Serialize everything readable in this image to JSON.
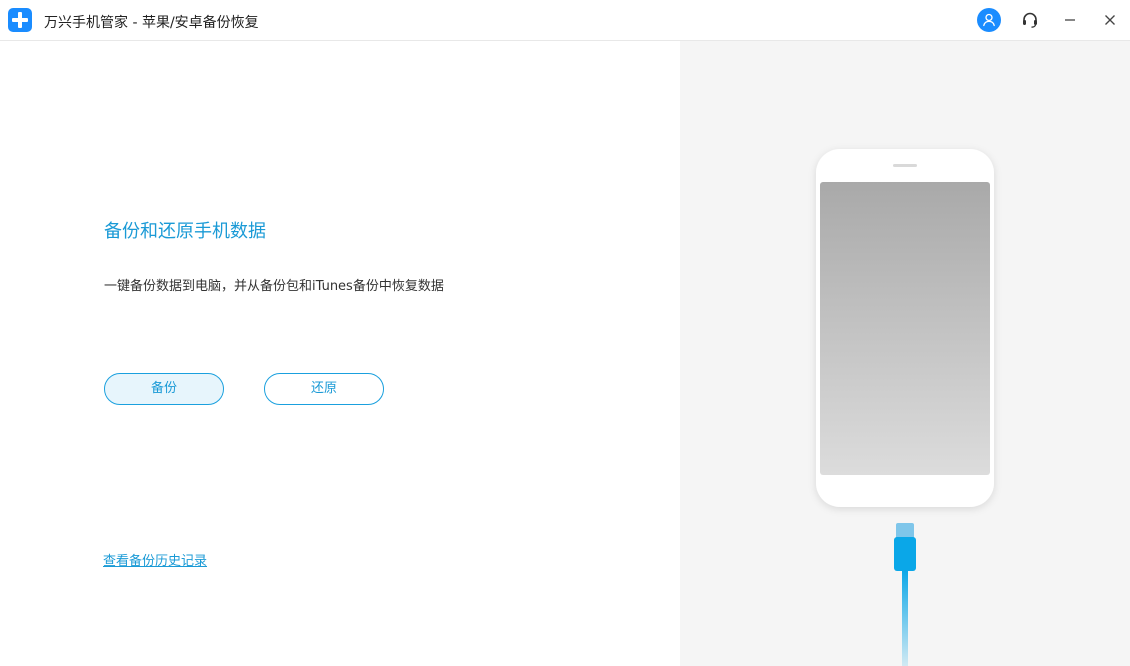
{
  "titlebar": {
    "title": "万兴手机管家 - 苹果/安卓备份恢复",
    "icons": {
      "logo": "plus-logo-icon",
      "account": "user-icon",
      "support": "headset-icon",
      "minimize": "minimize-icon",
      "close": "close-icon"
    }
  },
  "main": {
    "heading": "备份和还原手机数据",
    "description": "一键备份数据到电脑，并从备份包和iTunes备份中恢复数据",
    "backup_label": "备份",
    "restore_label": "还原",
    "history_link": "查看备份历史记录"
  },
  "illustration": {
    "subject": "phone-with-cable"
  },
  "colors": {
    "accent": "#1a9ad6",
    "brand_blue": "#1a8cff",
    "right_panel_bg": "#f5f5f5",
    "cable": "#0aa7e8"
  }
}
